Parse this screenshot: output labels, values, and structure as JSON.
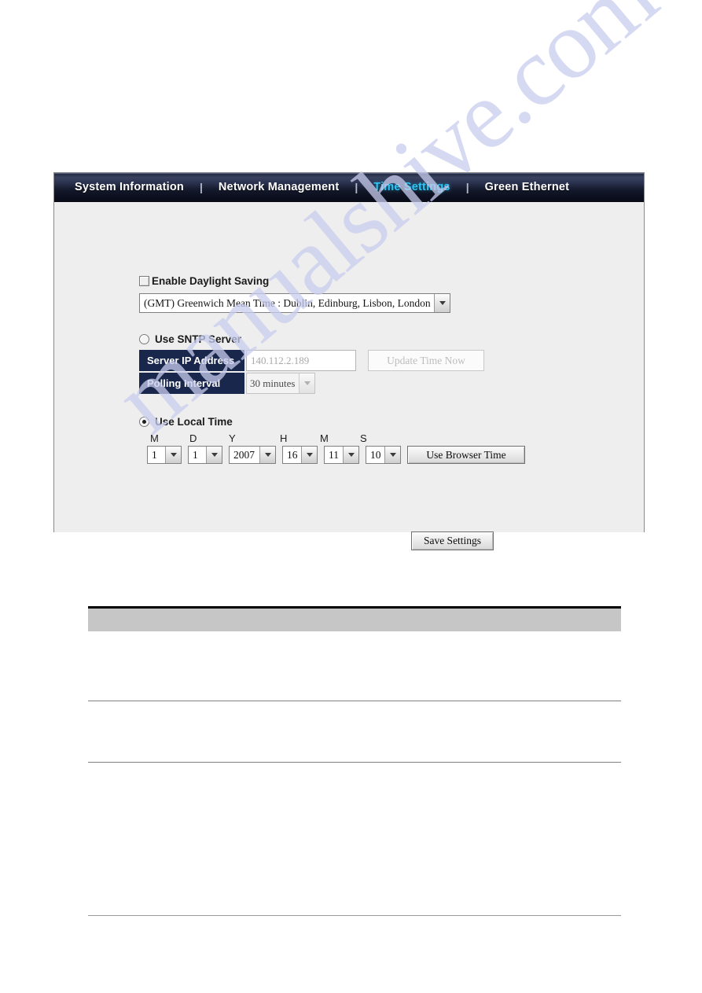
{
  "nav": {
    "items": [
      {
        "label": "System Information",
        "active": false
      },
      {
        "label": "Network Management",
        "active": false
      },
      {
        "label": "Time Settings",
        "active": true
      },
      {
        "label": "Green Ethernet",
        "active": false
      }
    ],
    "separator": "|",
    "active_color": "#2fc6f7",
    "bar_color": "#151a2c"
  },
  "form": {
    "daylight": {
      "label": "Enable Daylight Saving",
      "checked": false
    },
    "timezone": {
      "value": "(GMT) Greenwich Mean Time : Dublin, Edinburg, Lisbon, London"
    },
    "sntp": {
      "radio_label": "Use SNTP Server",
      "selected": false,
      "server_ip_label": "Server IP Address",
      "server_ip_value": "140.112.2.189",
      "update_button": "Update Time Now",
      "polling_label": "Polling Interval",
      "polling_value": "30 minutes",
      "label_bg": "#18274b"
    },
    "local": {
      "radio_label": "Use Local Time",
      "selected": true,
      "column_labels": [
        "M",
        "D",
        "Y",
        "H",
        "M",
        "S"
      ],
      "values": [
        "1",
        "1",
        "2007",
        "16",
        "11",
        "10"
      ],
      "browser_button": "Use Browser Time"
    },
    "save_button": "Save Settings"
  },
  "doc_table": {
    "header_cells": [
      ""
    ],
    "rows": [
      [
        ""
      ],
      [
        ""
      ]
    ]
  },
  "watermark": {
    "text": "manualshive.com",
    "color": "#c9cdee"
  }
}
